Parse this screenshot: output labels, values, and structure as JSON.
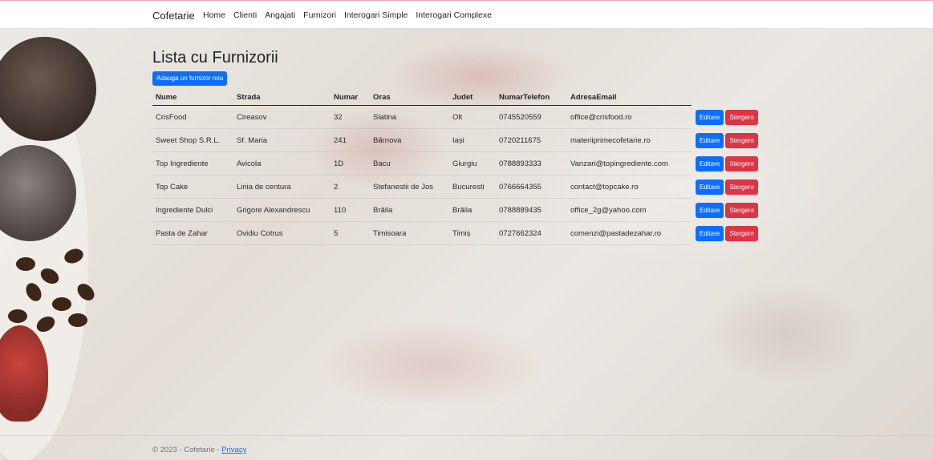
{
  "nav": {
    "brand": "Cofetarie",
    "links": [
      "Home",
      "Clienti",
      "Angajati",
      "Furnizori",
      "Interogari Simple",
      "Interogari Complexe"
    ]
  },
  "page": {
    "title": "Lista cu Furnizorii",
    "add_button": "Adauga un furnizor nou"
  },
  "table": {
    "headers": [
      "Nume",
      "Strada",
      "Numar",
      "Oras",
      "Judet",
      "NumarTelefon",
      "AdresaEmail"
    ],
    "edit_label": "Editare",
    "delete_label": "Stergere",
    "rows": [
      [
        "CrisFood",
        "Cireasov",
        "32",
        "Slatina",
        "Olt",
        "0745520559",
        "office@crisfood.ro"
      ],
      [
        "Sweet Shop S.R.L.",
        "Sf. Maria",
        "241",
        "Bârnova",
        "Iași",
        "0720211675",
        "materiiprimecofetarie.ro"
      ],
      [
        "Top Ingrediente",
        "Avicola",
        "1D",
        "Bacu",
        "Giurgiu",
        "0788893333",
        "Vanzari@topingrediente.com"
      ],
      [
        "Top Cake",
        "Linia de centura",
        "2",
        "Stefanestii de Jos",
        "Bucuresti",
        "0766664355",
        "contact@topcake.ro"
      ],
      [
        "Ingrediente Dulci",
        "Grigore Alexandrescu",
        "110",
        "Brăila",
        "Brăila",
        "0788889435",
        "office_2g@yahoo.com"
      ],
      [
        "Pasta de Zahar",
        "Ovidiu Cotrus",
        "5",
        "Timisoara",
        "Timiș",
        "0727662324",
        "comenzi@pastadezahar.ro"
      ]
    ]
  },
  "footer": {
    "text": "© 2023 - Cofetarie - ",
    "privacy": "Privacy"
  },
  "colors": {
    "primary": "#0d6efd",
    "danger": "#dc3545"
  }
}
